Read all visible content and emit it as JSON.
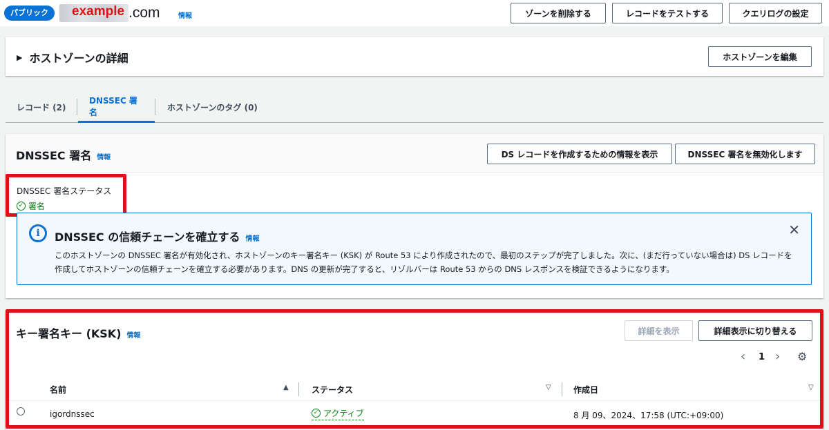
{
  "header": {
    "badge": "パブリック",
    "domain_overlay": "example",
    "domain_suffix": ".com",
    "info": "情報",
    "buttons": [
      "ゾーンを削除する",
      "レコードをテストする",
      "クエリログの設定"
    ]
  },
  "hosted_zone_details": {
    "title": "ホストゾーンの詳細",
    "edit_button": "ホストゾーンを編集"
  },
  "tabs": [
    {
      "label": "レコード (2)",
      "active": false
    },
    {
      "label": "DNSSEC 署名",
      "active": true
    },
    {
      "label": "ホストゾーンのタグ (0)",
      "active": false
    }
  ],
  "dnssec": {
    "title": "DNSSEC 署名",
    "info": "情報",
    "buttons": [
      "DS レコードを作成するための情報を表示",
      "DNSSEC 署名を無効化します"
    ],
    "status_label": "DNSSEC 署名ステータス",
    "status_value": "署名",
    "alert": {
      "title": "DNSSEC の信頼チェーンを確立する",
      "info": "情報",
      "body": "このホストゾーンの DNSSEC 署名が有効化され、ホストゾーンのキー署名キー (KSK) が Route 53 により作成されたので、最初のステップが完了しました。次に、(まだ行っていない場合は) DS レコードを作成してホストゾーンの信頼チェーンを確立する必要があります。DNS の更新が完了すると、リゾルバーは Route 53 からの DNS レスポンスを検証できるようになります。"
    }
  },
  "ksk": {
    "title": "キー署名キー (KSK)",
    "info": "情報",
    "view_details_button": "詳細を表示",
    "toggle_details_button": "詳細表示に切り替える",
    "page": "1",
    "columns": [
      "名前",
      "ステータス",
      "作成日"
    ],
    "rows": [
      {
        "name": "igordnssec",
        "status": "アクティブ",
        "created": "8 月 09、2024、17:58 (UTC:+09:00)"
      }
    ]
  },
  "colors": {
    "accent": "#0972d3",
    "success": "#037f0c",
    "highlight": "#e0101b"
  }
}
